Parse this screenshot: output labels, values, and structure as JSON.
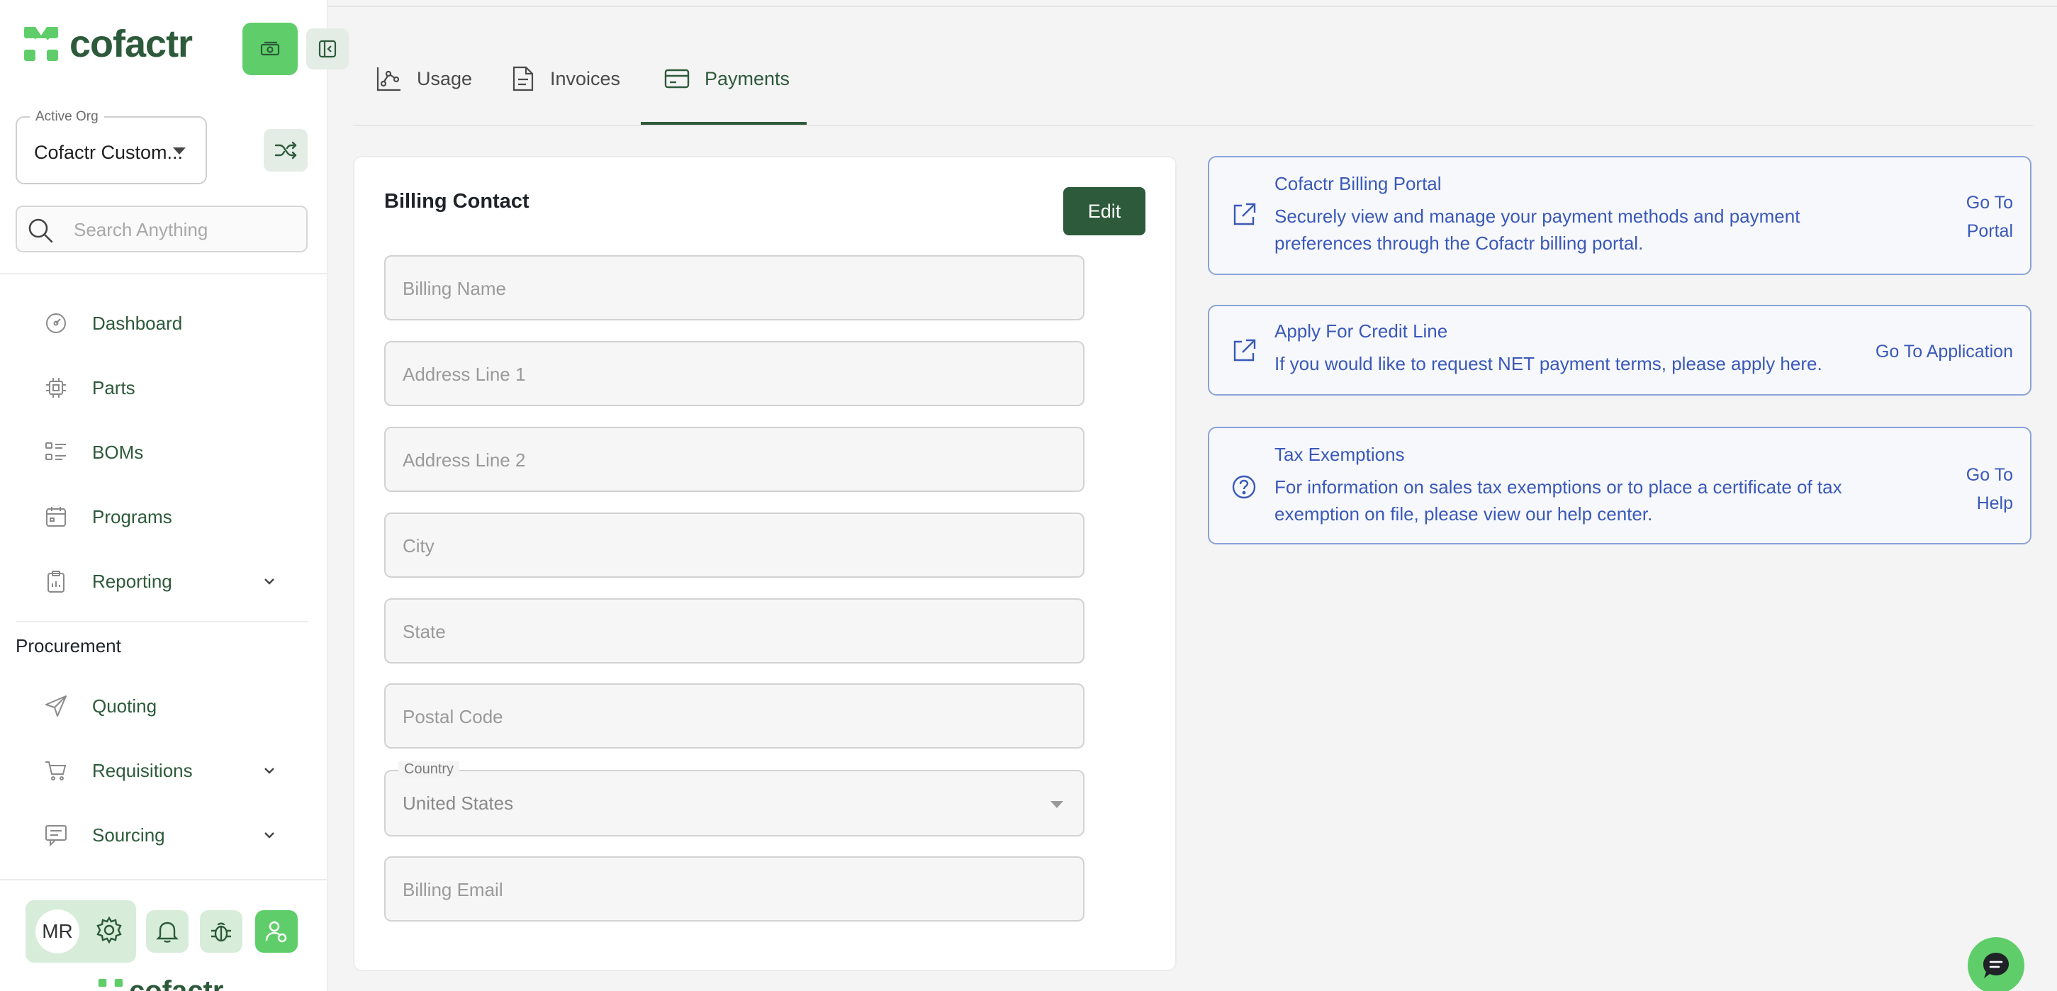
{
  "brand": {
    "name": "cofactr",
    "color": "#2d5a3a",
    "accent": "#5fce6a"
  },
  "org": {
    "legend": "Active Org",
    "value": "Cofactr Custom..."
  },
  "search": {
    "placeholder": "Search Anything"
  },
  "nav": {
    "items": [
      {
        "label": "Dashboard",
        "icon": "gauge-icon"
      },
      {
        "label": "Parts",
        "icon": "chip-icon"
      },
      {
        "label": "BOMs",
        "icon": "list-icon"
      },
      {
        "label": "Programs",
        "icon": "calendar-icon"
      },
      {
        "label": "Reporting",
        "icon": "clipboard-icon"
      }
    ],
    "procurement_title": "Procurement",
    "procurement_items": [
      {
        "label": "Quoting",
        "icon": "send-icon"
      },
      {
        "label": "Requisitions",
        "icon": "cart-icon"
      },
      {
        "label": "Sourcing",
        "icon": "message-icon"
      }
    ]
  },
  "user": {
    "initials": "MR"
  },
  "tabs": [
    {
      "label": "Usage",
      "icon": "chart-icon"
    },
    {
      "label": "Invoices",
      "icon": "document-icon"
    },
    {
      "label": "Payments",
      "icon": "credit-card-icon",
      "active": true
    }
  ],
  "billing": {
    "title": "Billing Contact",
    "edit_label": "Edit",
    "fields": {
      "name": "Billing Name",
      "address1": "Address Line 1",
      "address2": "Address Line 2",
      "city": "City",
      "state": "State",
      "postal": "Postal Code",
      "email": "Billing Email"
    },
    "country": {
      "legend": "Country",
      "value": "United States"
    }
  },
  "info": [
    {
      "title": "Cofactr Billing Portal",
      "desc1": "Securely view and manage your payment methods and payment",
      "desc2": "preferences through the Cofactr billing portal.",
      "link1": "Go To",
      "link2": "Portal",
      "icon": "external-link-icon"
    },
    {
      "title": "Apply For Credit Line",
      "desc1": "If you would like to request NET payment terms, please apply here.",
      "link1": "Go To Application",
      "icon": "external-link-icon"
    },
    {
      "title": "Tax Exemptions",
      "desc1": "For information on sales tax exemptions or to place a certificate of tax",
      "desc2": "exemption on file, please view our help center.",
      "link1": "Go To",
      "link2": "Help",
      "icon": "help-circle-icon"
    }
  ],
  "colors": {
    "info_blue": "#3a59b8",
    "info_border": "#8aa3d8"
  }
}
